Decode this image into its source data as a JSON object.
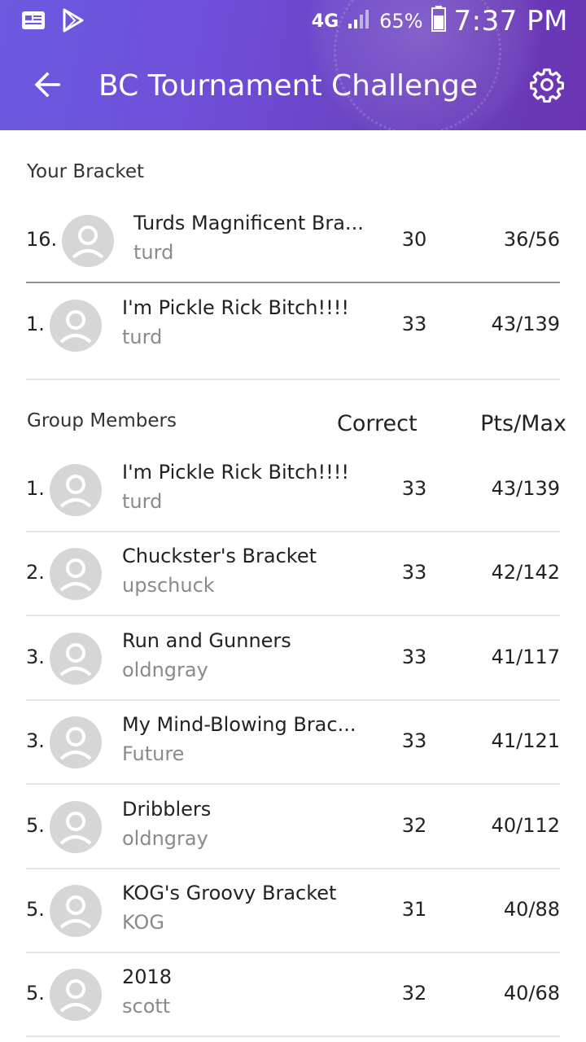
{
  "status_bar": {
    "network": "4G",
    "battery": "65%",
    "time": "7:37 PM"
  },
  "app_bar": {
    "title": "BC Tournament Challenge",
    "back_icon": "arrow-left-icon",
    "settings_icon": "gear-icon"
  },
  "your_bracket": {
    "label": "Your Bracket",
    "rows": [
      {
        "rank": "16.",
        "name": "Turds Magnificent Bra...",
        "user": "turd",
        "correct": "30",
        "pts": "36/56"
      },
      {
        "rank": "1.",
        "name": "I'm Pickle Rick Bitch!!!!",
        "user": "turd",
        "correct": "33",
        "pts": "43/139"
      }
    ]
  },
  "group_members": {
    "label": "Group Members",
    "col_correct": "Correct",
    "col_pts": "Pts/Max",
    "rows": [
      {
        "rank": "1.",
        "name": "I'm Pickle Rick Bitch!!!!",
        "user": "turd",
        "correct": "33",
        "pts": "43/139"
      },
      {
        "rank": "2.",
        "name": "Chuckster's Bracket",
        "user": "upschuck",
        "correct": "33",
        "pts": "42/142"
      },
      {
        "rank": "3.",
        "name": "Run and Gunners",
        "user": "oldngray",
        "correct": "33",
        "pts": "41/117"
      },
      {
        "rank": "3.",
        "name": "My Mind-Blowing Brac...",
        "user": "Future",
        "correct": "33",
        "pts": "41/121"
      },
      {
        "rank": "5.",
        "name": "Dribblers",
        "user": "oldngray",
        "correct": "32",
        "pts": "40/112"
      },
      {
        "rank": "5.",
        "name": "KOG's Groovy Bracket",
        "user": "KOG",
        "correct": "31",
        "pts": "40/88"
      },
      {
        "rank": "5.",
        "name": "2018",
        "user": "scott",
        "correct": "32",
        "pts": "40/68"
      }
    ]
  },
  "colors": {
    "header_start": "#6a5ae0",
    "header_end": "#6a35b3",
    "avatar_bg": "#d6d6d6",
    "subtext": "#8a8a8a"
  }
}
